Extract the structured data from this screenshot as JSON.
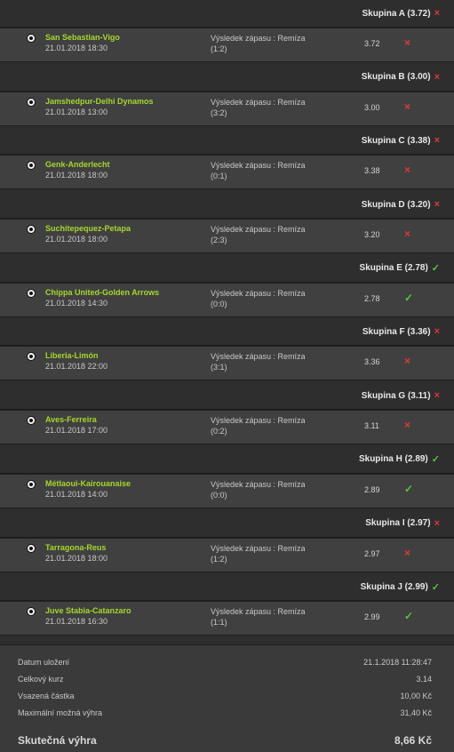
{
  "groups": [
    {
      "header": "Skupina A (3.72)",
      "status": "lost",
      "match": {
        "teams": "San Sebastian-Vigo",
        "date": "21.01.2018 18:30",
        "result_label": "Výsledek zápasu : Remíza",
        "score": "(1:2)",
        "odds": "3.72"
      }
    },
    {
      "header": "Skupina B (3.00)",
      "status": "lost",
      "match": {
        "teams": "Jamshedpur-Delhi Dynamos",
        "date": "21.01.2018 13:00",
        "result_label": "Výsledek zápasu : Remíza",
        "score": "(3:2)",
        "odds": "3.00"
      }
    },
    {
      "header": "Skupina C (3.38)",
      "status": "lost",
      "match": {
        "teams": "Genk-Anderlecht",
        "date": "21.01.2018 18:00",
        "result_label": "Výsledek zápasu : Remíza",
        "score": "(0:1)",
        "odds": "3.38"
      }
    },
    {
      "header": "Skupina D (3.20)",
      "status": "lost",
      "match": {
        "teams": "Suchitepequez-Petapa",
        "date": "21.01.2018 18:00",
        "result_label": "Výsledek zápasu : Remíza",
        "score": "(2:3)",
        "odds": "3.20"
      }
    },
    {
      "header": "Skupina E (2.78)",
      "status": "won",
      "match": {
        "teams": "Chippa United-Golden Arrows",
        "date": "21.01.2018 14:30",
        "result_label": "Výsledek zápasu : Remíza",
        "score": "(0:0)",
        "odds": "2.78"
      }
    },
    {
      "header": "Skupina F (3.36)",
      "status": "lost",
      "match": {
        "teams": "Liberia-Limón",
        "date": "21.01.2018 22:00",
        "result_label": "Výsledek zápasu : Remíza",
        "score": "(3:1)",
        "odds": "3.36"
      }
    },
    {
      "header": "Skupina G (3.11)",
      "status": "lost",
      "match": {
        "teams": "Aves-Ferreira",
        "date": "21.01.2018 17:00",
        "result_label": "Výsledek zápasu : Remíza",
        "score": "(0:2)",
        "odds": "3.11"
      }
    },
    {
      "header": "Skupina H (2.89)",
      "status": "won",
      "match": {
        "teams": "Métlaoui-Kairouanaise",
        "date": "21.01.2018 14:00",
        "result_label": "Výsledek zápasu : Remíza",
        "score": "(0:0)",
        "odds": "2.89"
      }
    },
    {
      "header": "Skupina I (2.97)",
      "status": "lost",
      "match": {
        "teams": "Tarragona-Reus",
        "date": "21.01.2018 18:00",
        "result_label": "Výsledek zápasu : Remíza",
        "score": "(1:2)",
        "odds": "2.97"
      }
    },
    {
      "header": "Skupina J (2.99)",
      "status": "won",
      "match": {
        "teams": "Juve Stabia-Catanzaro",
        "date": "21.01.2018 16:30",
        "result_label": "Výsledek zápasu : Remíza",
        "score": "(1:1)",
        "odds": "2.99"
      }
    }
  ],
  "icons": {
    "lost": "×",
    "won": "✓",
    "match": "soccer-ball-icon"
  },
  "colors": {
    "team": "#a6d62d",
    "lost": "#e03a3a",
    "won": "#57c43d"
  },
  "summary": {
    "rows": [
      {
        "label": "Datum uložení",
        "value": "21.1.2018 11:28:47"
      },
      {
        "label": "Celkový kurz",
        "value": "3.14"
      },
      {
        "label": "Vsazená částka",
        "value": "10,00 Kč"
      },
      {
        "label": "Maximální možná výhra",
        "value": "31,40 Kč"
      }
    ],
    "total_label": "Skutečná výhra",
    "total_value": "8,66 Kč"
  }
}
